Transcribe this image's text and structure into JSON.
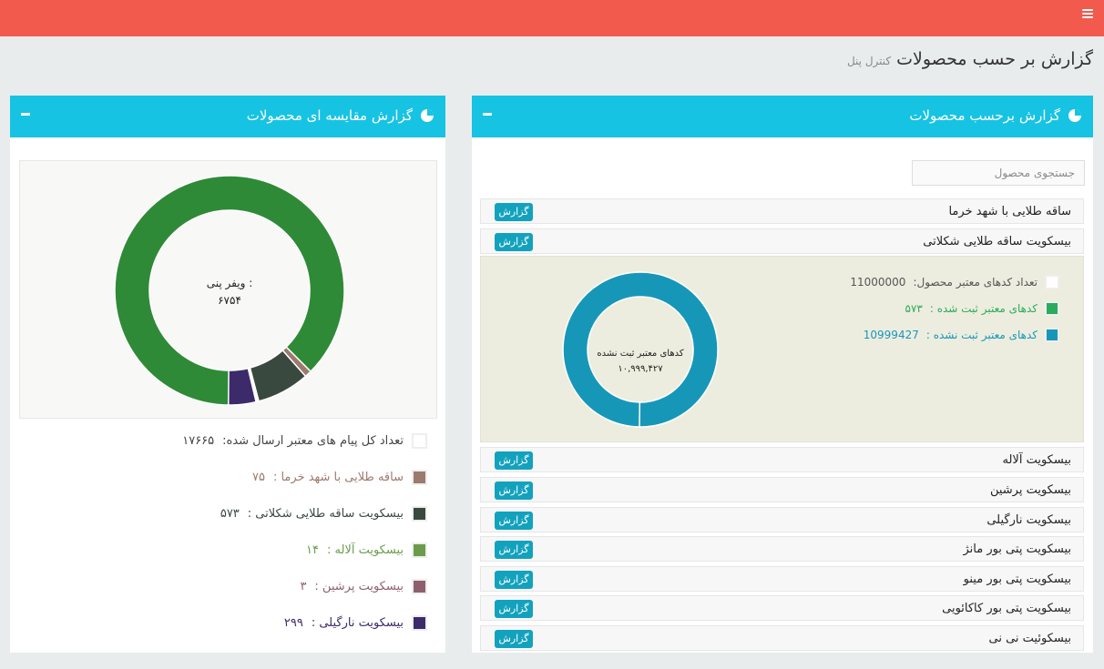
{
  "header": {
    "bg": "#f25a4e",
    "menu_icon": "bars-icon"
  },
  "page": {
    "title": "گزارش بر حسب محصولات",
    "subtitle": "کنترل پنل"
  },
  "right_panel": {
    "title": "گزارش برحسب محصولات",
    "title_icon": "pie-chart-icon",
    "search_placeholder": "جستجوی محصول",
    "report_label": "گزارش",
    "products": [
      "ساقه طلایی با شهد خرما",
      "بیسکویت ساقه طلایی شکلاتی",
      "بیسکویت آلاله",
      "بیسکویت پرشین",
      "بیسکویت نارگیلی",
      "بیسکویت پتی بور مانژ",
      "بیسکویت پتی بور مینو",
      "بیسکویت پتی بور کاکائویی",
      "بیسکوئیت نی نی"
    ],
    "expanded": {
      "legend": [
        {
          "label": "تعداد کدهای معتبر محصول:",
          "value": "11000000",
          "color": "#ffffff",
          "text_color": "#555555"
        },
        {
          "label": "کدهای معتبر ثبت شده :",
          "value": "۵۷۳",
          "color": "#2bab5e",
          "text_color": "#2bab5e"
        },
        {
          "label": "کدهای معتبر ثبت نشده :",
          "value": "10999427",
          "color": "#1797b8",
          "text_color": "#1797b8"
        }
      ],
      "donut_center_label": "کدهای معتبر ثبت نشده",
      "donut_center_value": "۱۰,۹۹۹,۴۲۷",
      "donut": {
        "registered": 573,
        "unregistered": 10999427
      }
    }
  },
  "left_panel": {
    "title": "گزارش مقایسه ای محصولات",
    "title_icon": "pie-chart-icon",
    "donut_center_label": "ویفر پنی :",
    "donut_center_value": "۶۷۵۴",
    "legend": [
      {
        "label": "تعداد کل پیام های معتبر ارسال شده:",
        "value": "۱۷۶۶۵",
        "color": "#ffffff",
        "text_color": "#444444"
      },
      {
        "label": "ساقه طلایی با شهد خرما :",
        "value": "۷۵",
        "color": "#9c7a6e",
        "text_color": "#9c7a6e"
      },
      {
        "label": "بیسکویت ساقه طلایی شکلاتی :",
        "value": "۵۷۳",
        "color": "#39493f",
        "text_color": "#39493f"
      },
      {
        "label": "بیسکویت آلاله :",
        "value": "۱۴",
        "color": "#6c9b4c",
        "text_color": "#6c9b4c"
      },
      {
        "label": "بیسکویت پرشین :",
        "value": "۳",
        "color": "#8e5f6d",
        "text_color": "#8e5f6d"
      },
      {
        "label": "بیسکویت نارگیلی :",
        "value": "۲۹۹",
        "color": "#3d2a6b",
        "text_color": "#3d2a6b"
      }
    ]
  },
  "chart_data": [
    {
      "type": "pie",
      "title": "",
      "categories": [
        "کدهای معتبر ثبت شده",
        "کدهای معتبر ثبت نشده"
      ],
      "values": [
        573,
        10999427
      ],
      "colors": [
        "#2bab5e",
        "#1797b8"
      ]
    },
    {
      "type": "pie",
      "title": "",
      "categories": [
        "ویفر پنی",
        "ساقه طلایی با شهد خرما",
        "بیسکویت ساقه طلایی شکلاتی",
        "بیسکویت آلاله",
        "بیسکویت پرشین",
        "بیسکویت نارگیلی"
      ],
      "values": [
        6754,
        75,
        573,
        14,
        3,
        299
      ],
      "colors": [
        "#2f8a37",
        "#9c7a6e",
        "#39493f",
        "#6c9b4c",
        "#8e5f6d",
        "#3d2a6b"
      ]
    }
  ]
}
